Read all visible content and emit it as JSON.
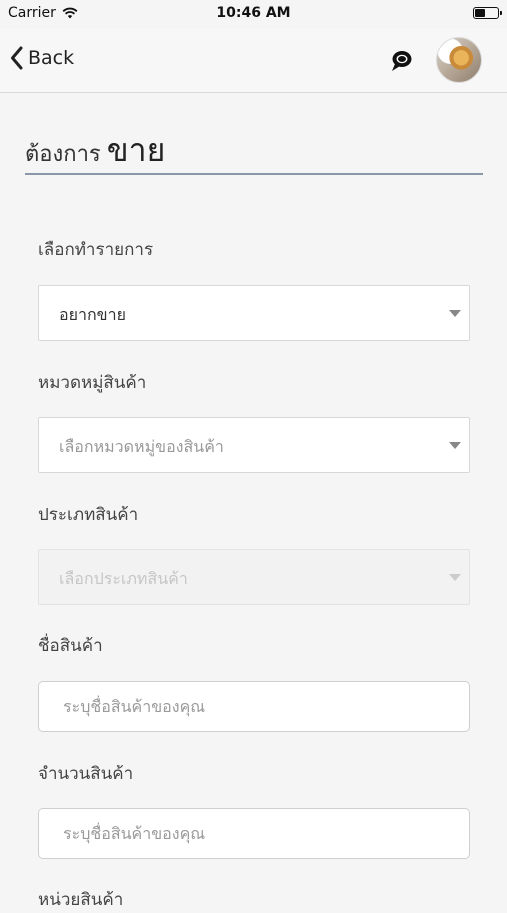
{
  "status_bar": {
    "carrier": "Carrier",
    "time": "10:46 AM",
    "battery_level": 0.5
  },
  "nav": {
    "back_label": "Back",
    "chat_icon": "chat-bubble-icon",
    "avatar": "profile-avatar"
  },
  "page": {
    "title_prefix": "ต้องการ",
    "title_main": "ขาย"
  },
  "form": {
    "transaction": {
      "label": "เลือกทำรายการ",
      "value": "อยากขาย"
    },
    "category": {
      "label": "หมวดหมู่สินค้า",
      "placeholder": "เลือกหมวดหมู่ของสินค้า"
    },
    "product_type": {
      "label": "ประเภทสินค้า",
      "placeholder": "เลือกประเภทสินค้า"
    },
    "product_name": {
      "label": "ชื่อสินค้า",
      "placeholder": "ระบุชื่อสินค้าของคุณ"
    },
    "quantity": {
      "label": "จำนวนสินค้า",
      "placeholder": "ระบุชื่อสินค้าของคุณ"
    },
    "unit": {
      "label": "หน่วยสินค้า"
    }
  },
  "colors": {
    "title_underline": "#8a97a8",
    "background": "#f5f5f5"
  }
}
